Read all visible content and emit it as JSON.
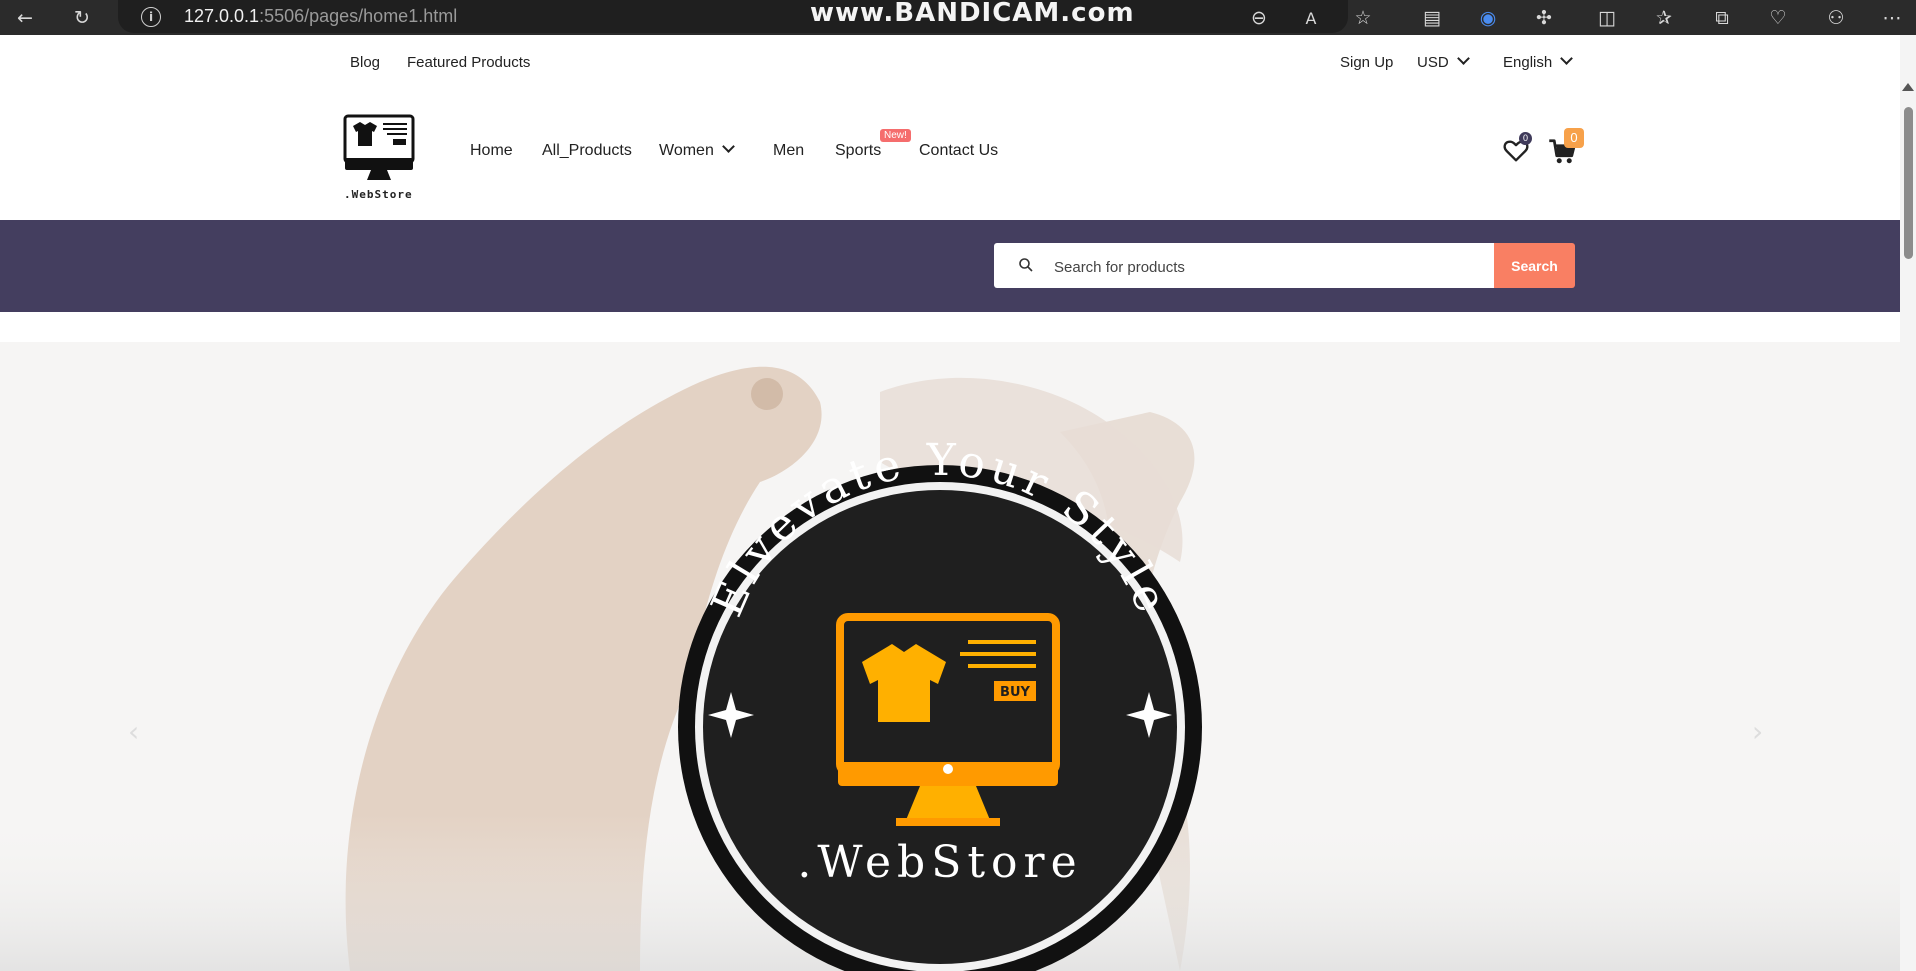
{
  "browser": {
    "url_host": "127.0.0.1",
    "url_rest": ":5506/pages/home1.html",
    "watermark": "www.BANDICAM.com"
  },
  "topbar": {
    "blog": "Blog",
    "featured": "Featured Products",
    "signup": "Sign Up",
    "currency": "USD",
    "language": "English"
  },
  "logo": {
    "text": ".WebStore"
  },
  "nav": {
    "home": "Home",
    "all_products": "All_Products",
    "women": "Women",
    "men": "Men",
    "sports": "Sports",
    "sports_badge": "New!",
    "contact": "Contact Us"
  },
  "header_icons": {
    "wishlist_count": "0",
    "cart_count": "0"
  },
  "search": {
    "placeholder": "Search for products",
    "button": "Search"
  },
  "hero": {
    "badge_arc_text": "Elvevate Your Style",
    "badge_buy": "BUY",
    "badge_brand": ".WebStore"
  },
  "colors": {
    "strip": "#443e5f",
    "search_button": "#f97f63",
    "badge_orange": "#f7a14a",
    "logo_orange": "#ff9a00"
  }
}
